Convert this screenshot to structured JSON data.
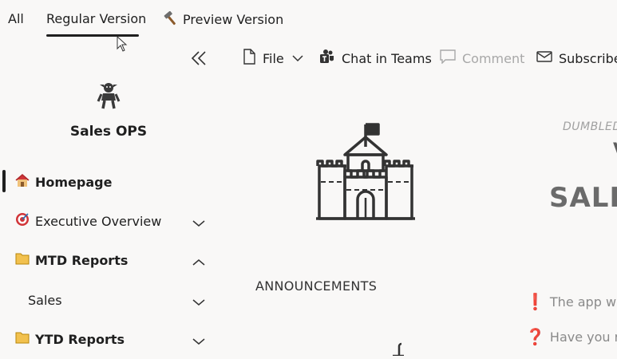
{
  "tabs": [
    {
      "label": "All"
    },
    {
      "label": "Regular Version"
    },
    {
      "label": "Preview Version"
    }
  ],
  "toolbar": {
    "file_label": "File",
    "teams_label": "Chat in Teams",
    "comment_label": "Comment",
    "subscribe_label": "Subscribe"
  },
  "sidebar": {
    "title": "Sales OPS",
    "items": [
      {
        "label": "Homepage",
        "icon": "house-icon"
      },
      {
        "label": "Executive Overview",
        "icon": "target-icon"
      },
      {
        "label": "MTD Reports",
        "icon": "folder-icon"
      },
      {
        "label": "Sales"
      },
      {
        "label": "YTD Reports",
        "icon": "folder-icon"
      }
    ]
  },
  "content": {
    "announcements": "ANNOUNCEMENTS",
    "dumbledore_text": "DUMBLED",
    "v_text": "V",
    "sales_text": "SALE",
    "msg1": "The app will",
    "msg2": "Have you reg"
  },
  "colors": {
    "text": "#1f1f1f",
    "muted": "#8a8a8a",
    "alert_red": "#d13438",
    "background": "#f9f8f7"
  }
}
